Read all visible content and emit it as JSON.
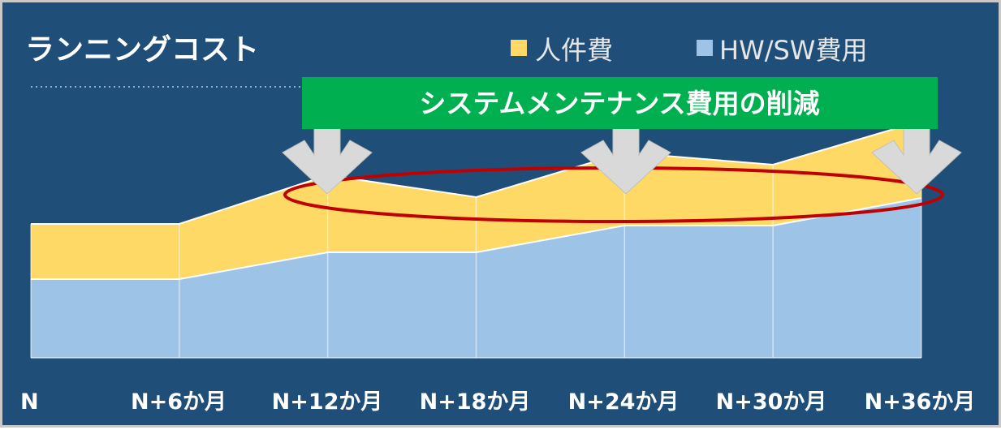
{
  "colors": {
    "background": "#1f4e79",
    "personnel": "#ffd966",
    "hwsw": "#9dc3e6",
    "banner": "#00b050",
    "ellipse": "#c00000",
    "arrow": "#d9d9d9"
  },
  "banner": {
    "label": "システムメンテナンス費用の削減"
  },
  "chart_data": {
    "type": "area",
    "stacked": true,
    "title": "ランニングコスト",
    "categories": [
      "N",
      "N+6か月",
      "N+12か月",
      "N+18か月",
      "N+24か月",
      "N+30か月",
      "N+36か月"
    ],
    "series": [
      {
        "name": "HW/SW費用",
        "color": "#9dc3e6",
        "values": [
          97,
          97,
          130,
          130,
          163,
          163,
          197
        ]
      },
      {
        "name": "人件費",
        "color": "#ffd966",
        "values": [
          68,
          68,
          95,
          68,
          90,
          75,
          95
        ]
      }
    ],
    "ylim": [
      0,
      300
    ],
    "legend_position": "top",
    "grid": false
  }
}
